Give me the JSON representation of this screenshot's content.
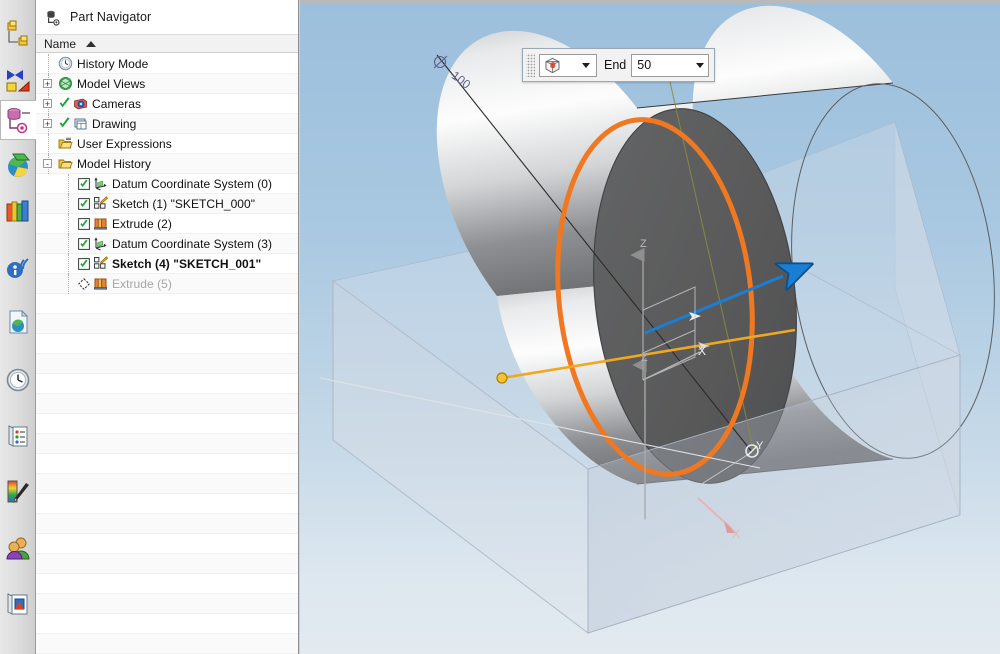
{
  "app": {
    "panel_title": "Part Navigator",
    "panel_title_icon": "part-navigator-icon"
  },
  "resource_bar": {
    "items": [
      {
        "name": "assembly-navigator-icon",
        "title": "Assembly Navigator",
        "active": false
      },
      {
        "name": "constraint-navigator-icon",
        "title": "Constraint Navigator",
        "active": false
      },
      {
        "name": "part-navigator-icon",
        "title": "Part Navigator",
        "active": true
      },
      {
        "name": "reuse-library-icon",
        "title": "Reuse Library",
        "active": false
      },
      {
        "name": "html-help-icon",
        "title": "HD3D Tools",
        "active": false
      },
      {
        "name": "web-browser-icon",
        "title": "Web Browser",
        "active": false
      },
      {
        "name": "history-icon",
        "title": "History",
        "active": false
      },
      {
        "name": "process-studio-icon",
        "title": "Process Studio",
        "active": false
      },
      {
        "name": "system-scene-icon",
        "title": "System Scene Navigator",
        "active": false
      },
      {
        "name": "roles-icon",
        "title": "Roles",
        "active": false
      },
      {
        "name": "system-visualization-icon",
        "title": "System Visualization",
        "active": false
      }
    ]
  },
  "part_navigator": {
    "column_header": "Name",
    "sort_direction": "ascending",
    "tree": [
      {
        "label": "History Mode",
        "icon": "clock-icon",
        "indent": 0,
        "expander": "",
        "checkbox": "none",
        "green_check": false,
        "bold": false,
        "dim": false
      },
      {
        "label": "Model Views",
        "icon": "model-views-icon",
        "indent": 0,
        "expander": "+",
        "checkbox": "none",
        "green_check": false,
        "bold": false,
        "dim": false
      },
      {
        "label": "Cameras",
        "icon": "cameras-icon",
        "indent": 0,
        "expander": "+",
        "checkbox": "none",
        "green_check": true,
        "bold": false,
        "dim": false
      },
      {
        "label": "Drawing",
        "icon": "drawing-icon",
        "indent": 0,
        "expander": "+",
        "checkbox": "none",
        "green_check": true,
        "bold": false,
        "dim": false
      },
      {
        "label": "User Expressions",
        "icon": "folder-expr-icon",
        "indent": 0,
        "expander": "",
        "checkbox": "none",
        "green_check": false,
        "bold": false,
        "dim": false
      },
      {
        "label": "Model History",
        "icon": "folder-icon",
        "indent": 0,
        "expander": "-",
        "checkbox": "none",
        "green_check": false,
        "bold": false,
        "dim": false
      },
      {
        "label": "Datum Coordinate System (0)",
        "icon": "datum-csys-icon",
        "indent": 1,
        "expander": "",
        "checkbox": "checked",
        "green_check": false,
        "bold": false,
        "dim": false
      },
      {
        "label": "Sketch (1) \"SKETCH_000\"",
        "icon": "sketch-icon",
        "indent": 1,
        "expander": "",
        "checkbox": "checked",
        "green_check": false,
        "bold": false,
        "dim": false
      },
      {
        "label": "Extrude (2)",
        "icon": "extrude-icon",
        "indent": 1,
        "expander": "",
        "checkbox": "checked",
        "green_check": false,
        "bold": false,
        "dim": false
      },
      {
        "label": "Datum Coordinate System (3)",
        "icon": "datum-csys-icon",
        "indent": 1,
        "expander": "",
        "checkbox": "checked",
        "green_check": false,
        "bold": false,
        "dim": false
      },
      {
        "label": "Sketch (4) \"SKETCH_001\"",
        "icon": "sketch-icon",
        "indent": 1,
        "expander": "",
        "checkbox": "checked",
        "green_check": false,
        "bold": true,
        "dim": false
      },
      {
        "label": "Extrude (5)",
        "icon": "extrude-icon",
        "indent": 1,
        "expander": "",
        "checkbox": "diamond",
        "green_check": false,
        "bold": false,
        "dim": true
      }
    ],
    "empty_rows": 18
  },
  "extrude_toolbar": {
    "type_icon": "extrude-body-icon",
    "type_dropdown_arrow": "chevron-down-icon",
    "end_label": "End",
    "value": "50",
    "value_dropdown_arrow": "chevron-down-icon",
    "grip": "drag-grip"
  },
  "viewport": {
    "background_top_color": "#9cbfdc",
    "background_bottom_color": "#e3eaf0",
    "dimension_label": "100",
    "dimension_symbol": "⌀",
    "sketch_curve_color": "#f07820",
    "direction_arrow_color": "#1a7fd4",
    "radius_line_color": "#f0a81e",
    "preview_box_color": "#c8d2de",
    "axis_labels": [
      {
        "text": "Z",
        "name": "axis-label-z-upper"
      },
      {
        "text": "X",
        "name": "axis-label-x-upper"
      },
      {
        "text": "Z",
        "name": "axis-label-z-lower"
      },
      {
        "text": "Y",
        "name": "axis-label-y-lower"
      },
      {
        "text": "X",
        "name": "axis-label-x-lower"
      }
    ]
  }
}
